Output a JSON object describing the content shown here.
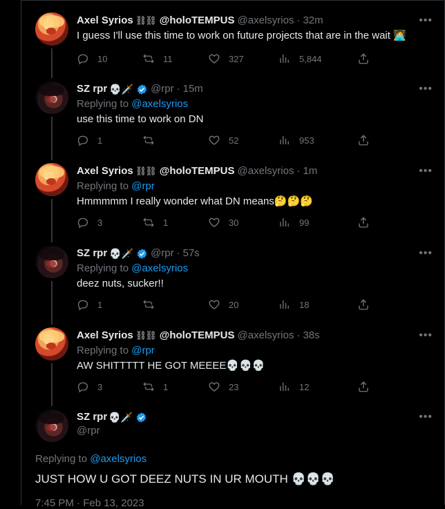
{
  "tweets": [
    {
      "avatar": "axel",
      "name": "Axel Syrios",
      "name_suffix": "@holoTEMPUS",
      "badge": "chain",
      "handle": "@axelsyrios",
      "time": "32m",
      "replying_to": "",
      "text": "I guess I'll use this time to work on future projects that are in the wait 🧑‍💻",
      "replies": "10",
      "reposts": "11",
      "likes": "327",
      "views": "5,844"
    },
    {
      "avatar": "sz",
      "name": "SZ rpr",
      "name_suffix": "💀🗡️",
      "badge": "verified",
      "handle": "@rpr",
      "time": "15m",
      "replying_to": "@axelsyrios",
      "text": "use this time to work on DN",
      "replies": "1",
      "reposts": "",
      "likes": "52",
      "views": "953"
    },
    {
      "avatar": "axel",
      "name": "Axel Syrios",
      "name_suffix": "@holoTEMPUS",
      "badge": "chain",
      "handle": "@axelsyrios",
      "time": "1m",
      "replying_to": "@rpr",
      "text": "Hmmmmm I really wonder what DN means🤔🤔🤔",
      "replies": "3",
      "reposts": "1",
      "likes": "30",
      "views": "99"
    },
    {
      "avatar": "sz",
      "name": "SZ rpr",
      "name_suffix": "💀🗡️",
      "badge": "verified",
      "handle": "@rpr",
      "time": "57s",
      "replying_to": "@axelsyrios",
      "text": "deez nuts, sucker!!",
      "replies": "1",
      "reposts": "",
      "likes": "20",
      "views": "18"
    },
    {
      "avatar": "axel",
      "name": "Axel Syrios",
      "name_suffix": "@holoTEMPUS",
      "badge": "chain",
      "handle": "@axelsyrios",
      "time": "38s",
      "replying_to": "@rpr",
      "text": "AW SHITTTTT HE GOT MEEEE💀💀💀",
      "replies": "3",
      "reposts": "1",
      "likes": "23",
      "views": "12"
    }
  ],
  "main": {
    "name": "SZ rpr",
    "name_suffix": "💀🗡️",
    "handle": "@rpr",
    "replying_label": "Replying to",
    "replying_to": "@axelsyrios",
    "text": "JUST HOW U GOT DEEZ NUTS IN UR MOUTH 💀💀💀",
    "meta": "7:45 PM · Feb 13, 2023"
  },
  "labels": {
    "replying": "Replying to",
    "sep": "·",
    "more": "•••"
  },
  "colors": {
    "accent": "#1d9bf0",
    "muted": "#71767b",
    "text": "#e7e9ea",
    "border": "#2f3336"
  },
  "icons": [
    "reply-icon",
    "repost-icon",
    "like-icon",
    "views-icon",
    "share-icon",
    "verified-icon",
    "more-icon"
  ]
}
